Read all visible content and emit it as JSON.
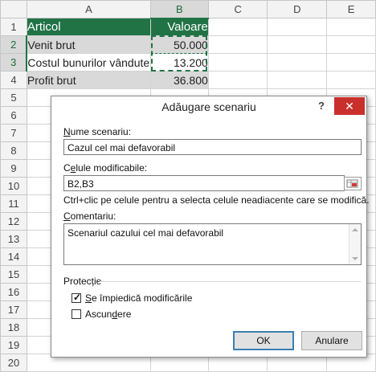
{
  "columns": [
    "A",
    "B",
    "C",
    "D",
    "E"
  ],
  "rows": [
    "1",
    "2",
    "3",
    "4",
    "5",
    "6",
    "7",
    "8",
    "9",
    "10",
    "11",
    "12",
    "13",
    "14",
    "15",
    "16",
    "17",
    "18",
    "19",
    "20"
  ],
  "cells": {
    "a1": "Articol",
    "b1": "Valoare",
    "a2": "Venit brut",
    "b2": "50.000",
    "a3": "Costul bunurilor vândute",
    "b3": "13.200",
    "a4": "Profit brut",
    "b4": "36.800"
  },
  "dialog": {
    "title": "Adăugare scenariu",
    "help": "?",
    "close": "✕",
    "name_label_u": "N",
    "name_label_rest": "ume scenariu:",
    "name_value": "Cazul cel mai defavorabil",
    "cells_label_pre": "C",
    "cells_label_u": "e",
    "cells_label_rest": "lule modificabile:",
    "cells_value": "B2,B3",
    "hint": "Ctrl+clic pe celule pentru a selecta celule neadiacente care se modifică.",
    "comment_label_u": "C",
    "comment_label_rest": "omentariu:",
    "comment_value": "Scenariul cazului cel mai defavorabil",
    "protection_label": "Protecție",
    "prevent_u": "S",
    "prevent_rest": "e împiedică modificările",
    "prevent_checked": true,
    "hide_pre": "Ascun",
    "hide_u": "d",
    "hide_rest": "ere",
    "hide_checked": false,
    "ok": "OK",
    "cancel": "Anulare"
  },
  "colors": {
    "header_fill": "#217346",
    "accent": "#217346",
    "close_button": "#c9302c"
  }
}
